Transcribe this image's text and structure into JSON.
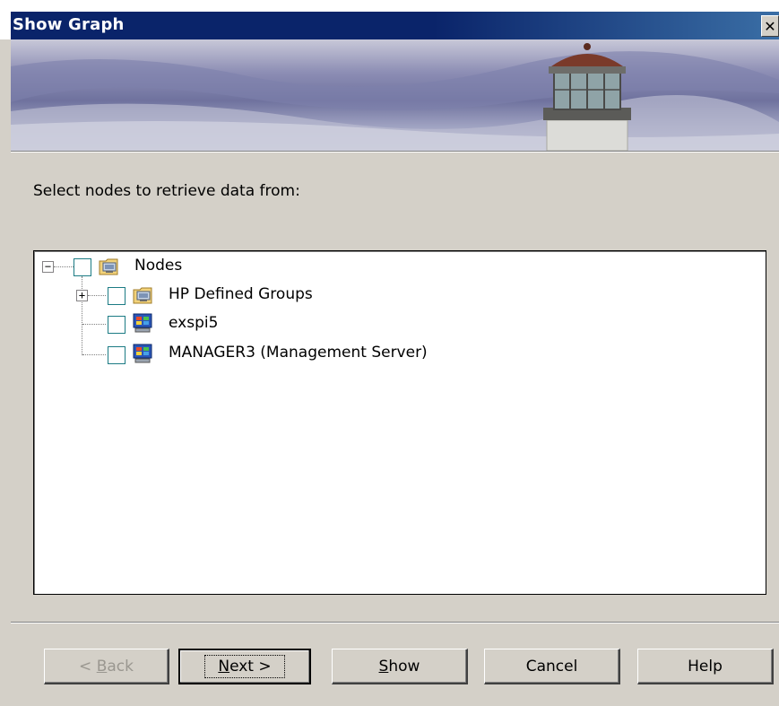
{
  "window": {
    "title": "Show Graph",
    "close_symbol": "✕"
  },
  "instruction": "Select nodes to retrieve data from:",
  "tree": {
    "root": {
      "label": "Nodes",
      "expander": "−",
      "icon": "node-group-icon"
    },
    "children": [
      {
        "label": "HP Defined Groups",
        "expander": "+",
        "icon": "node-group-icon"
      },
      {
        "label": "exspi5",
        "icon": "node-computer-icon"
      },
      {
        "label": "MANAGER3 (Management Server)",
        "icon": "node-computer-icon"
      }
    ]
  },
  "buttons": {
    "back": {
      "prefix": "< ",
      "mnemonic": "B",
      "rest": "ack"
    },
    "next": {
      "mnemonic": "N",
      "rest": "ext >"
    },
    "show": {
      "mnemonic": "S",
      "rest": "how"
    },
    "cancel": "Cancel",
    "help": "Help"
  },
  "colors": {
    "title_bar": "#0a246a",
    "dialog_bg": "#d4d0c8",
    "checkbox_border": "#1c7b84"
  }
}
